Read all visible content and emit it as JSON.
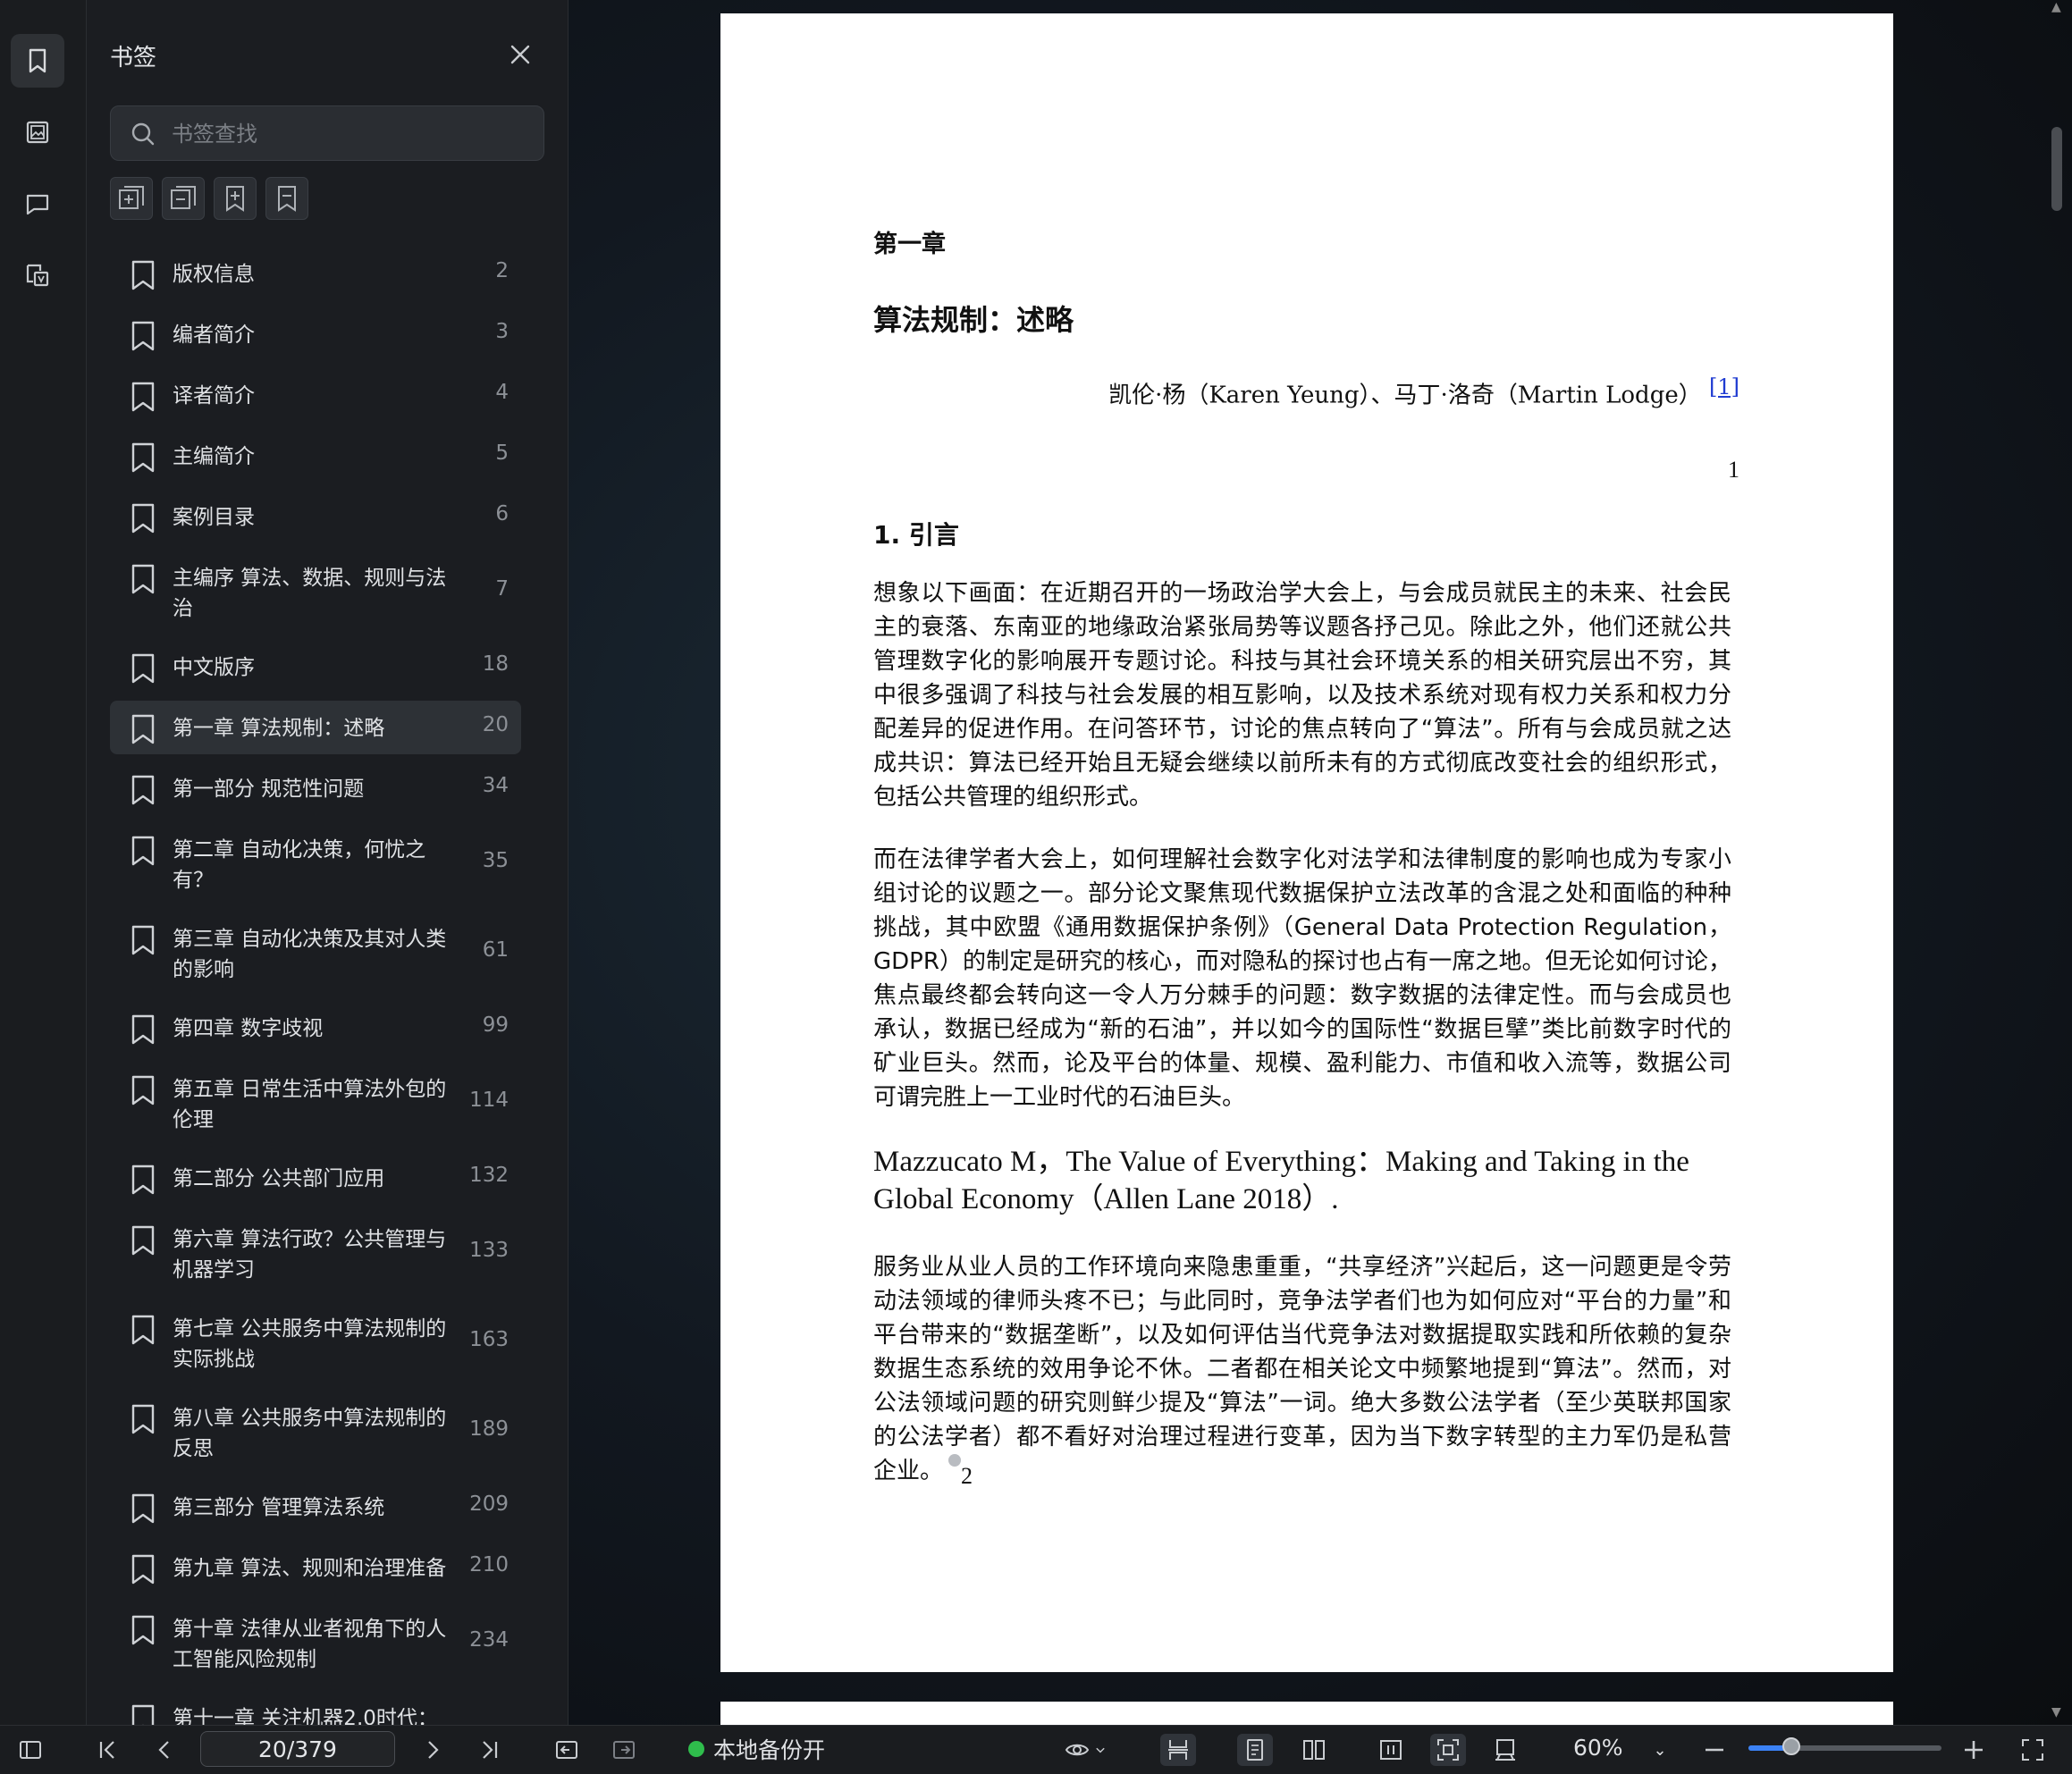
{
  "rail": {
    "items": [
      {
        "name": "bookmark-panel-icon",
        "active": true
      },
      {
        "name": "image-panel-icon",
        "active": false
      },
      {
        "name": "comment-panel-icon",
        "active": false
      },
      {
        "name": "extract-panel-icon",
        "active": false
      }
    ]
  },
  "bookmarks_panel": {
    "title": "书签",
    "search_placeholder": "书签查找",
    "items": [
      {
        "label": "版权信息",
        "page": "2"
      },
      {
        "label": "编者简介",
        "page": "3"
      },
      {
        "label": "译者简介",
        "page": "4"
      },
      {
        "label": "主编简介",
        "page": "5"
      },
      {
        "label": "案例目录",
        "page": "6"
      },
      {
        "label": "主编序 算法、数据、规则与法治",
        "page": "7"
      },
      {
        "label": "中文版序",
        "page": "18"
      },
      {
        "label": "第一章 算法规制：述略",
        "page": "20",
        "active": true
      },
      {
        "label": "第一部分 规范性问题",
        "page": "34"
      },
      {
        "label": "第二章 自动化决策，何忧之有？",
        "page": "35"
      },
      {
        "label": "第三章 自动化决策及其对人类的影响",
        "page": "61"
      },
      {
        "label": "第四章 数字歧视",
        "page": "99"
      },
      {
        "label": "第五章 日常生活中算法外包的伦理",
        "page": "114"
      },
      {
        "label": "第二部分 公共部门应用",
        "page": "132"
      },
      {
        "label": "第六章 算法行政？公共管理与机器学习",
        "page": "133"
      },
      {
        "label": "第七章 公共服务中算法规制的实际挑战",
        "page": "163"
      },
      {
        "label": "第八章 公共服务中算法规制的反思",
        "page": "189"
      },
      {
        "label": "第三部分 管理算法系统",
        "page": "209"
      },
      {
        "label": "第九章 算法、规则和治理准备",
        "page": "210"
      },
      {
        "label": "第十章 法律从业者视角下的人工智能风险规制",
        "page": "234"
      },
      {
        "label": "第十一章 关注机器2.0时代：",
        "page": ""
      }
    ]
  },
  "document": {
    "chapter": "第一章",
    "title": "算法规制：述略",
    "authors": "凯伦·杨（Karen Yeung）、马丁·洛奇（Martin Lodge）",
    "author_footnote": "[1]",
    "page_number": "1",
    "section": "1. 引言",
    "para1": "想象以下画面：在近期召开的一场政治学大会上，与会成员就民主的未来、社会民主的衰落、东南亚的地缘政治紧张局势等议题各抒己见。除此之外，他们还就公共管理数字化的影响展开专题讨论。科技与其社会环境关系的相关研究层出不穷，其中很多强调了科技与社会发展的相互影响，以及技术系统对现有权力关系和权力分配差异的促进作用。在问答环节，讨论的焦点转向了“算法”。所有与会成员就之达成共识：算法已经开始且无疑会继续以前所未有的方式彻底改变社会的组织形式，包括公共管理的组织形式。",
    "para2": "而在法律学者大会上，如何理解社会数字化对法学和法律制度的影响也成为专家小组讨论的议题之一。部分论文聚焦现代数据保护立法改革的含混之处和面临的种种挑战，其中欧盟《通用数据保护条例》（General Data Protection Regulation，GDPR）的制定是研究的核心，而对隐私的探讨也占有一席之地。但无论如何讨论，焦点最终都会转向这一令人万分棘手的问题：数字数据的法律定性。而与会成员也承认，数据已经成为“新的石油”，并以如今的国际性“数据巨擘”类比前数字时代的矿业巨头。然而，论及平台的体量、规模、盈利能力、市值和收入流等，数据公司可谓完胜上一工业时代的石油巨头。",
    "reference": "Mazzucato M，The Value of Everything：Making and Taking in the Global Economy（Allen Lane 2018）.",
    "para3": "服务业从业人员的工作环境向来隐患重重，“共享经济”兴起后，这一问题更是令劳动法领域的律师头疼不已；与此同时，竞争法学者们也为如何应对“平台的力量”和平台带来的“数据垄断”，以及如何评估当代竞争法对数据提取实践和所依赖的复杂数据生态系统的效用争论不休。二者都在相关论文中频繁地提到“算法”。然而，对公法领域问题的研究则鲜少提及“算法”一词。绝大多数公法学者（至少英联邦国家的公法学者）都不看好对治理过程进行变革，因为当下数字转型的主力军仍是私营企业。",
    "para3_note": "2"
  },
  "bottom_bar": {
    "page_indicator": "20/379",
    "backup_label": "本地备份开",
    "zoom_label": "60%",
    "zoom_level": 0.22
  }
}
